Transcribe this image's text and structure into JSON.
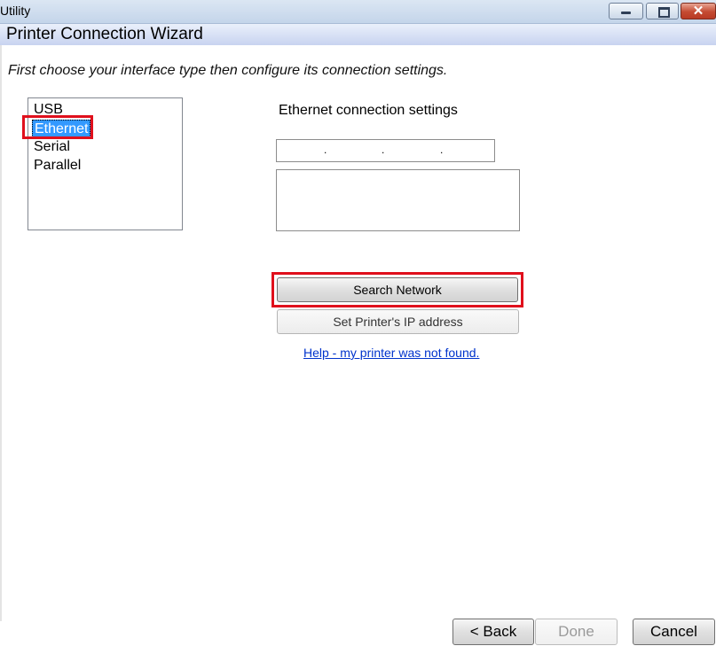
{
  "window": {
    "title": "Utility",
    "minimize_icon": "minimize-icon",
    "maximize_icon": "maximize-icon",
    "close_icon": "close-icon",
    "close_glyph": "✕"
  },
  "header": {
    "title": "Printer Connection Wizard"
  },
  "instruction": "First choose your interface type then configure its connection settings.",
  "interfaces": {
    "items": [
      "USB",
      "Ethernet",
      "Serial",
      "Parallel"
    ],
    "selected": "Ethernet"
  },
  "ethernet": {
    "label": "Ethernet connection settings",
    "ip_dots": [
      ".",
      ".",
      "."
    ],
    "search_button": "Search Network",
    "set_ip_button": "Set Printer's IP address",
    "help_link": "Help - my printer was not found."
  },
  "footer": {
    "back": "< Back",
    "done": "Done",
    "cancel": "Cancel"
  },
  "colors": {
    "selection": "#3399ff",
    "highlight_box": "#e0101c",
    "link": "#0033cc"
  }
}
